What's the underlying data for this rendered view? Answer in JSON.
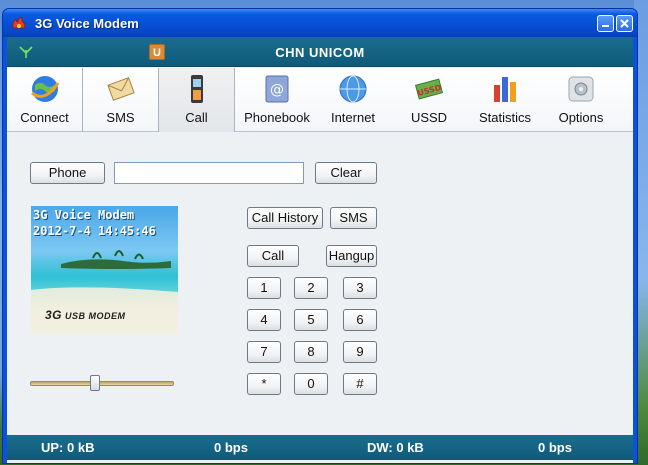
{
  "window": {
    "title": "3G Voice Modem"
  },
  "status_top": {
    "operator": "CHN UNICOM",
    "usim_badge": "U"
  },
  "toolbar": [
    {
      "label": "Connect",
      "icon": "globe-connect-icon"
    },
    {
      "label": "SMS",
      "icon": "envelope-icon"
    },
    {
      "label": "Call",
      "icon": "mobile-phone-icon"
    },
    {
      "label": "Phonebook",
      "icon": "address-book-icon"
    },
    {
      "label": "Internet",
      "icon": "internet-globe-icon"
    },
    {
      "label": "USSD",
      "icon": "ussd-icon"
    },
    {
      "label": "Statistics",
      "icon": "bar-chart-icon"
    },
    {
      "label": "Options",
      "icon": "options-gear-icon"
    }
  ],
  "dialer": {
    "phone_button": "Phone",
    "phone_value": "",
    "clear_button": "Clear",
    "call_history_button": "Call History",
    "sms_button": "SMS",
    "call_button": "Call",
    "hangup_button": "Hangup",
    "keys": [
      "1",
      "2",
      "3",
      "4",
      "5",
      "6",
      "7",
      "8",
      "9",
      "*",
      "0",
      "#"
    ],
    "volume_level": 0.45
  },
  "display": {
    "line1": "3G Voice Modem",
    "line2": "2012-7-4 14:45:46",
    "brand_big": "3G",
    "brand_small": "USB MODEM"
  },
  "status_bottom": {
    "up": "UP: 0 kB",
    "up_rate": "0 bps",
    "down": "DW: 0 kB",
    "down_rate": "0 bps"
  },
  "colors": {
    "titlebar": "#0651d6",
    "statusbar": "#13607f",
    "window_bg": "#eef1f4"
  }
}
